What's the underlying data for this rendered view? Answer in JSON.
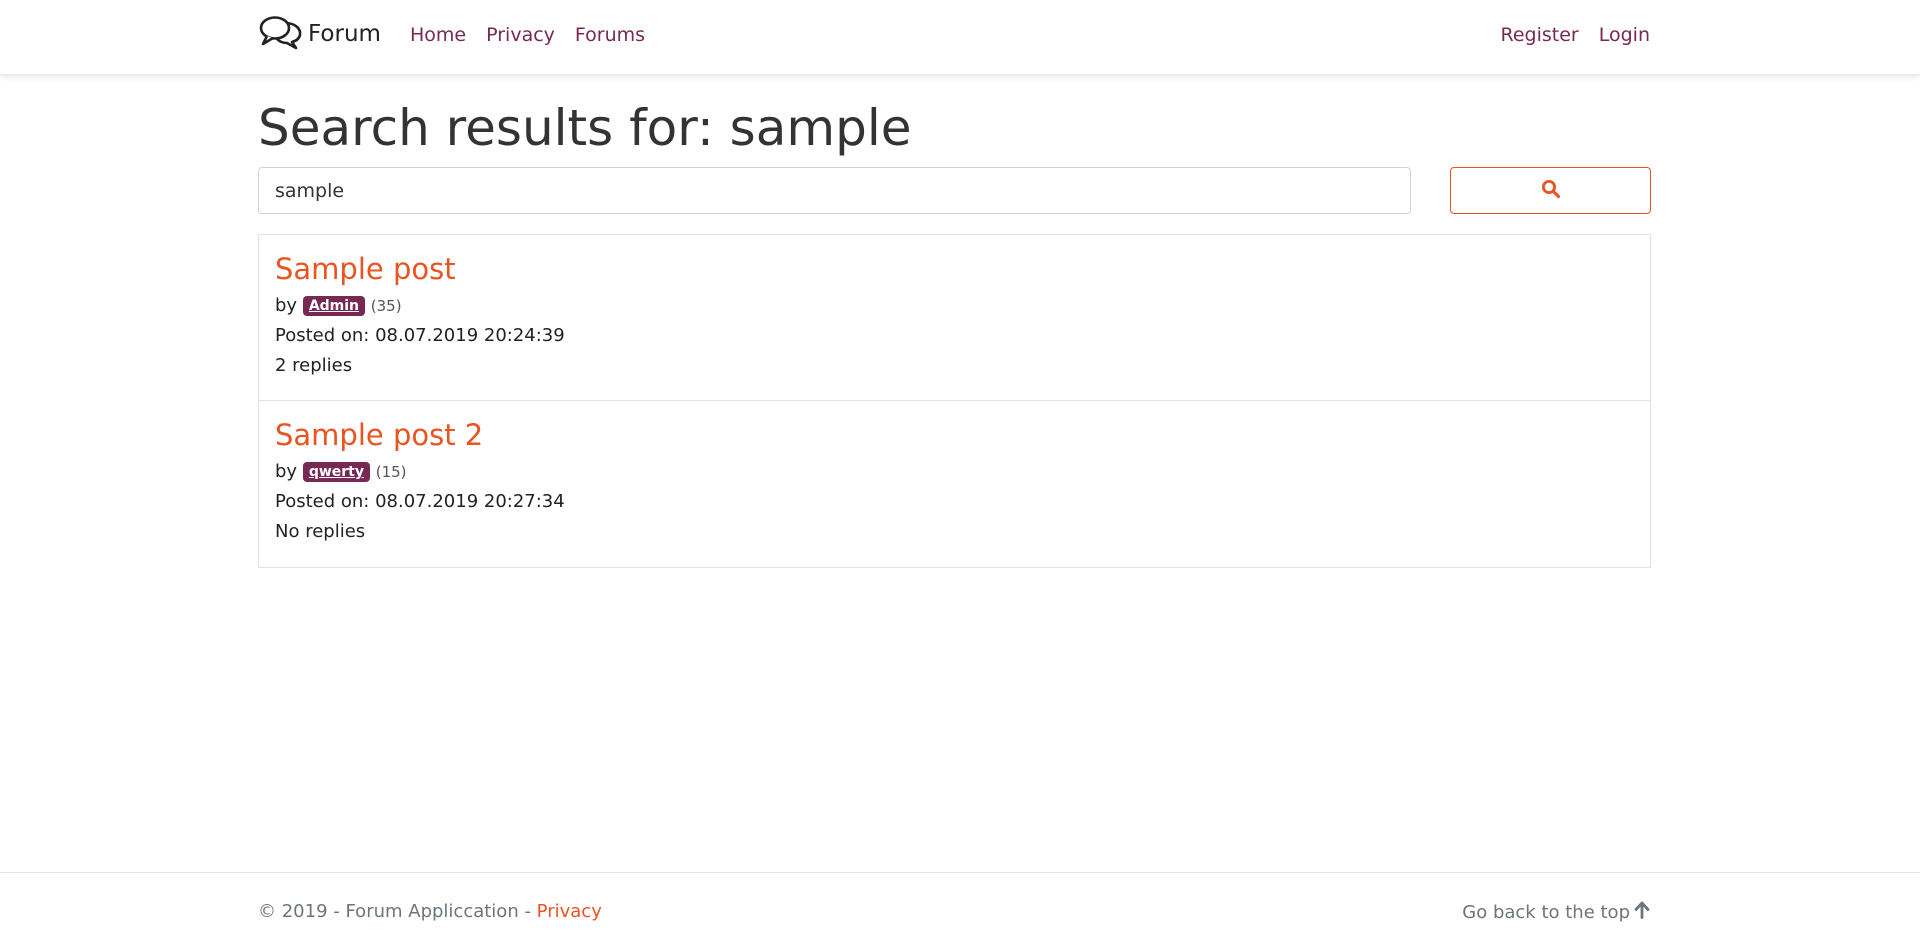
{
  "nav": {
    "brand": "Forum",
    "links": [
      "Home",
      "Privacy",
      "Forums"
    ],
    "right_links": [
      "Register",
      "Login"
    ]
  },
  "main": {
    "title": "Search results for: sample",
    "search": {
      "value": "sample"
    },
    "results": [
      {
        "title": "Sample post",
        "by": "by",
        "author": "Admin",
        "count": "(35)",
        "posted": "Posted on: 08.07.2019 20:24:39",
        "replies": "2 replies"
      },
      {
        "title": "Sample post 2",
        "by": "by",
        "author": "qwerty",
        "count": "(15)",
        "posted": "Posted on: 08.07.2019 20:27:34",
        "replies": "No replies"
      }
    ]
  },
  "footer": {
    "copyright": "© 2019 - Forum Appliccation - ",
    "privacy": "Privacy",
    "back_to_top": "Go back to the top"
  },
  "colors": {
    "accent": "#e95420",
    "nav_link": "#772953",
    "badge": "#772953",
    "muted": "#6c757d"
  },
  "icons": {
    "brand": "chat-bubbles-icon",
    "search": "search-icon",
    "back_to_top": "arrow-up-icon"
  }
}
